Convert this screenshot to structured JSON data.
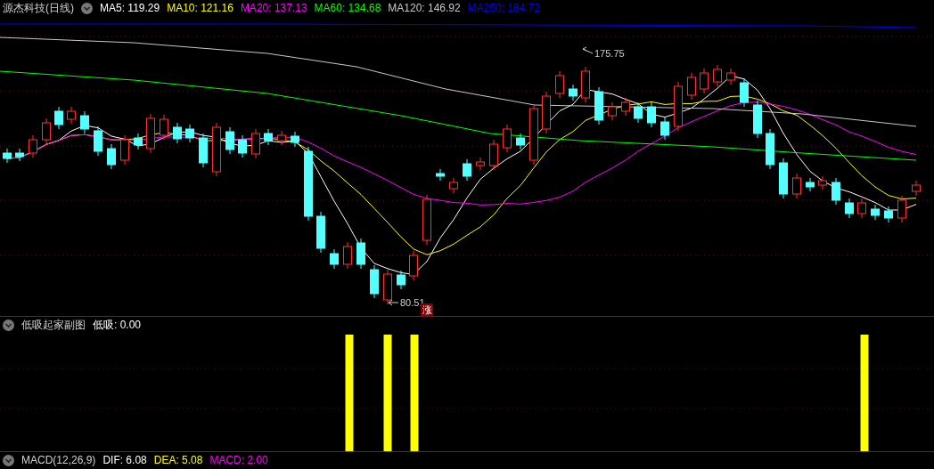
{
  "title": {
    "name": "源杰科技(日线)"
  },
  "ma_legend": [
    {
      "label": "MA5: 119.29",
      "color": "#ffffff"
    },
    {
      "label": "MA10: 121.16",
      "color": "#ffff00"
    },
    {
      "label": "MA20: 137.13",
      "color": "#ff00ff"
    },
    {
      "label": "MA60: 134.68",
      "color": "#00ff00"
    },
    {
      "label": "MA120: 146.92",
      "color": "#c8c8c8"
    },
    {
      "label": "MA250: 184.72",
      "color": "#0000ff"
    }
  ],
  "price_chart": {
    "high_label": "175.75",
    "low_label": "80.51",
    "badge": "涨"
  },
  "indicator": {
    "name": "低吸起家副图",
    "reading": "低吸: 0.00"
  },
  "macd": {
    "name": "MACD(12,26,9)",
    "items": [
      {
        "label": "DIF: 6.08",
        "color": "#ffffff"
      },
      {
        "label": "DEA: 5.08",
        "color": "#ffff00"
      },
      {
        "label": "MACD: 2.00",
        "color": "#ff00ff"
      }
    ]
  }
}
